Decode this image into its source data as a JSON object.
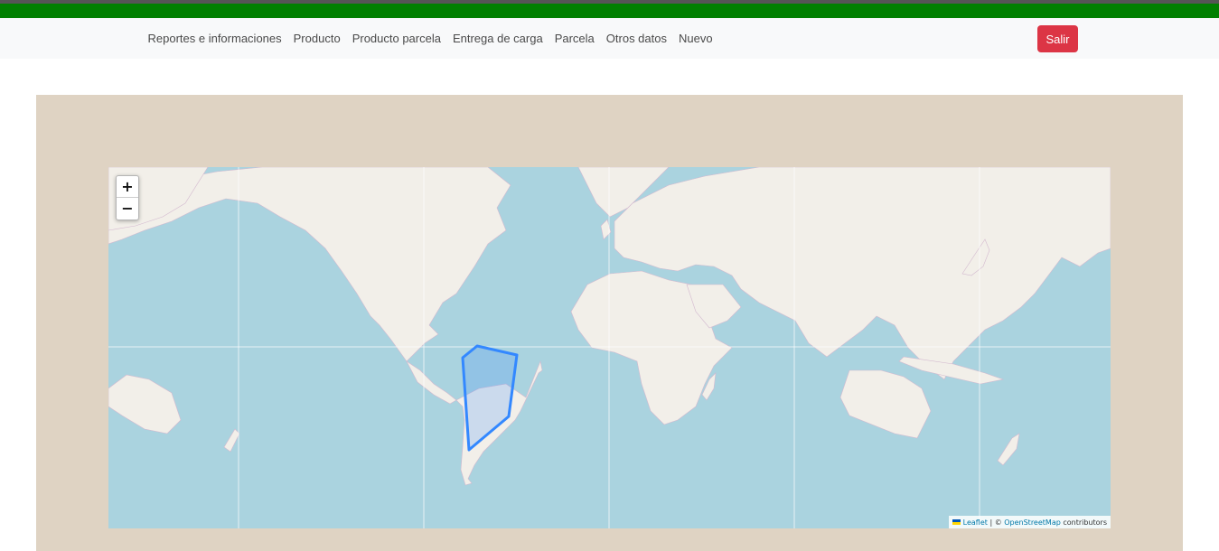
{
  "nav": {
    "links": [
      "Reportes e informaciones",
      "Producto",
      "Producto parcela",
      "Entrega de carga",
      "Parcela",
      "Otros datos",
      "Nuevo"
    ],
    "logout_label": "Salir"
  },
  "colors": {
    "top_band": "#008000",
    "logout_button": "#dc3545",
    "panel_bg": "#dfd3c3",
    "water": "#aad3df",
    "land": "#f2efe9",
    "polygon_stroke": "#3388ff"
  },
  "map": {
    "zoom_in_label": "+",
    "zoom_out_label": "−",
    "attribution": {
      "leaflet": "Leaflet",
      "separator": " | © ",
      "osm": "OpenStreetMap",
      "suffix": " contributors"
    }
  }
}
